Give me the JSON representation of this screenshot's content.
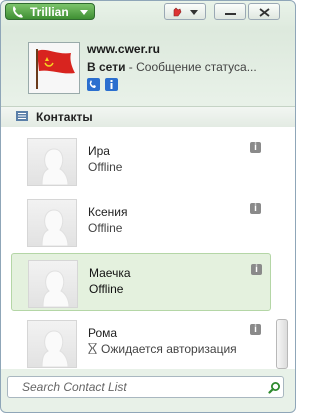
{
  "titlebar": {
    "app_label": "Trillian"
  },
  "profile": {
    "site": "www.cwer.ru",
    "status": "В сети",
    "status_message": " - Сообщение статуса..."
  },
  "contacts_header": {
    "label": "Контакты"
  },
  "contacts": [
    {
      "name": "Ира",
      "status": "Offline",
      "selected": false,
      "pending": false
    },
    {
      "name": "Ксения",
      "status": "Offline",
      "selected": false,
      "pending": false
    },
    {
      "name": "Маечка",
      "status": "Offline",
      "selected": true,
      "pending": false
    },
    {
      "name": "Рома",
      "status": "Ожидается авторизация",
      "selected": false,
      "pending": true
    }
  ],
  "search": {
    "placeholder": "Search Contact List"
  },
  "icons": {
    "app": "phone-icon",
    "menu": "hand-icon",
    "minimize": "minimize-icon",
    "close": "close-icon",
    "profile_1": "link-icon",
    "profile_2": "info-icon",
    "contacts_header": "list-icon",
    "search": "magnifier-icon"
  },
  "colors": {
    "accent_green": "#3f8f33",
    "selected_row": "#e4f1de"
  }
}
